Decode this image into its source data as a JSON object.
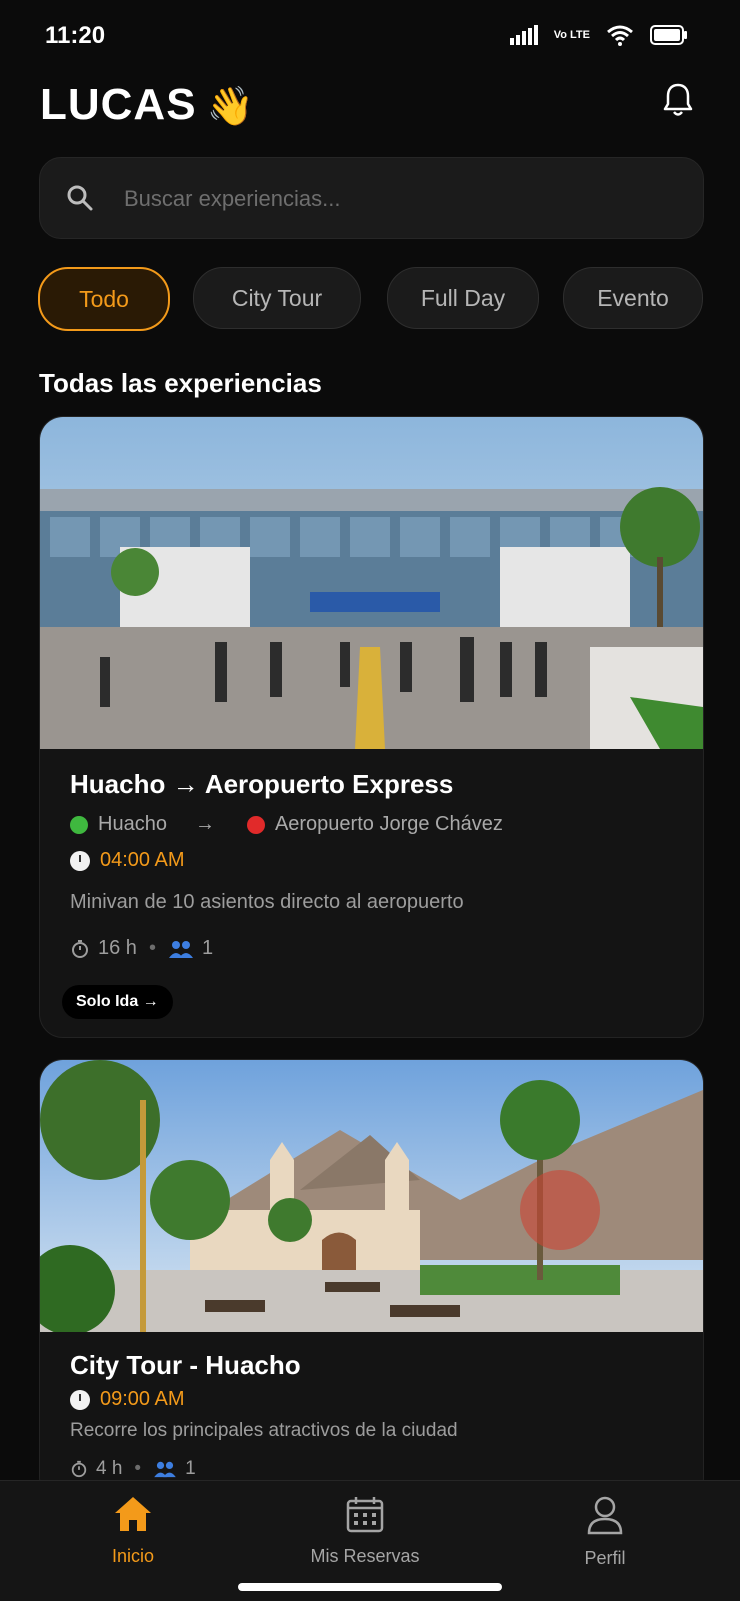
{
  "status_bar": {
    "time": "11:20",
    "network_label": "Vo LTE"
  },
  "header": {
    "greeting": "LUCAS",
    "wave_emoji": "👋"
  },
  "search": {
    "placeholder": "Buscar experiencias..."
  },
  "filters": [
    {
      "label": "Todo",
      "active": true
    },
    {
      "label": "City Tour",
      "active": false
    },
    {
      "label": "Full Day",
      "active": false
    },
    {
      "label": "Evento",
      "active": false
    }
  ],
  "section": {
    "title": "Todas las experiencias"
  },
  "experiences": [
    {
      "title": "Huacho → Aeropuerto Express",
      "origin": "Huacho",
      "route_arrow": "→",
      "destination": "Aeropuerto Jorge Chávez",
      "time": "04:00 AM",
      "description": "Minivan de 10 asientos directo al aeropuerto",
      "duration": "16 h",
      "seats": "1",
      "badge": "Solo Ida →"
    },
    {
      "title": "City Tour - Huacho",
      "time": "09:00 AM",
      "description": "Recorre los principales atractivos de la ciudad",
      "duration": "4 h",
      "seats": "1"
    }
  ],
  "bottom_nav": [
    {
      "label": "Inicio",
      "icon": "home-icon",
      "active": true
    },
    {
      "label": "Mis Reservas",
      "icon": "calendar-icon",
      "active": false
    },
    {
      "label": "Perfil",
      "icon": "user-icon",
      "active": false
    }
  ],
  "colors": {
    "accent": "#f39a1a",
    "background": "#0b0b0b",
    "card": "#141414"
  }
}
